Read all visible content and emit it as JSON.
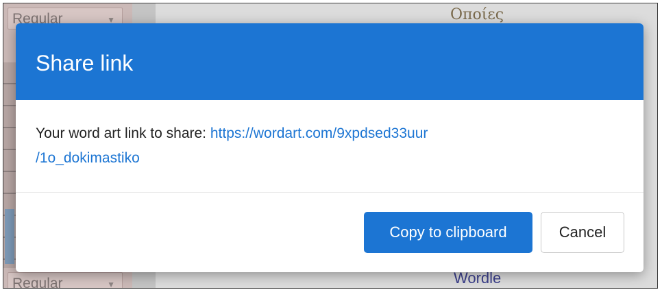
{
  "background": {
    "select_top": {
      "value": "Regular"
    },
    "select_bottom": {
      "value": "Regular"
    },
    "words": [
      "Οποίες",
      "Wordle"
    ]
  },
  "modal": {
    "title": "Share link",
    "body_text": "Your word art link to share: ",
    "link_text_line1": "https://wordart.com/9xpdsed33uur",
    "link_text_line2": "/1o_dokimastiko",
    "copy_button_label": "Copy to clipboard",
    "cancel_button_label": "Cancel"
  },
  "colors": {
    "accent": "#1c75d3",
    "header_text": "#ffffff",
    "body_text": "#222222"
  }
}
